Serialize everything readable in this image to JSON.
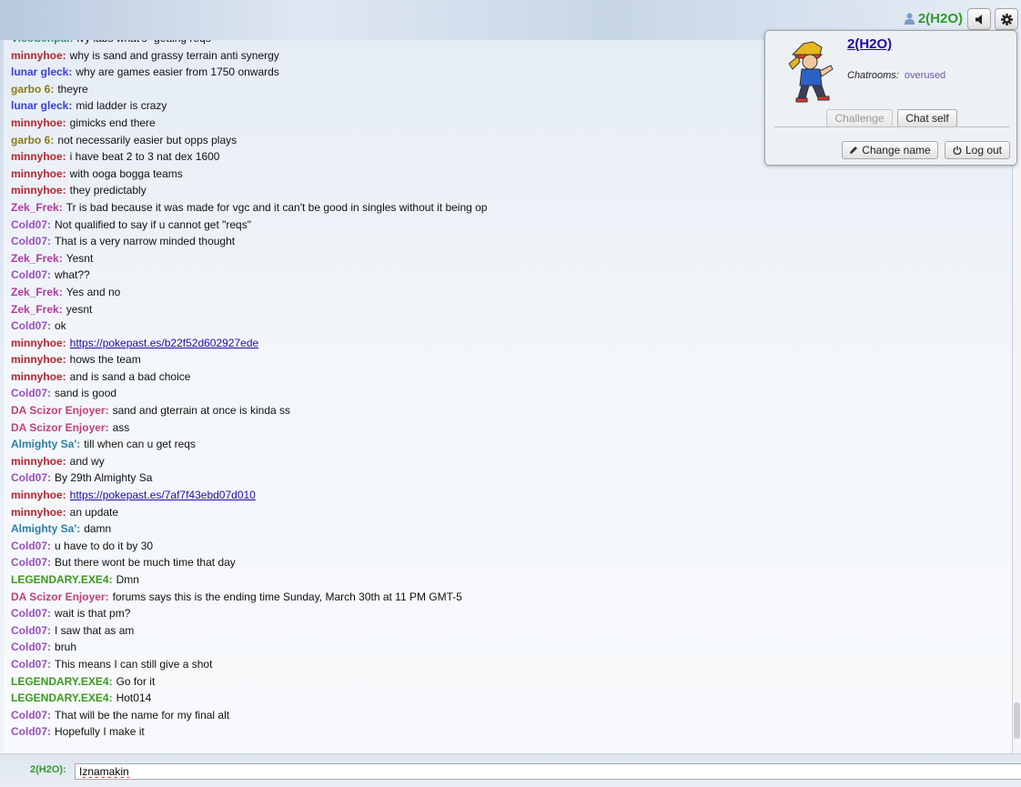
{
  "header": {
    "username": "2(H2O)",
    "colors": {
      "username": "#2d9a2d"
    }
  },
  "chat": {
    "messages": [
      {
        "user": "VicoSenpai:",
        "text": "ivy labs what's \"getting reqs\"",
        "color": "#2f8f6b"
      },
      {
        "user": "minnyhoe:",
        "text": "why is sand and grassy terrain anti synergy",
        "color": "#b3262f"
      },
      {
        "user": "lunar gleck:",
        "text": "why are games easier from 1750 onwards",
        "color": "#3b3fd6"
      },
      {
        "user": "garbo 6:",
        "text": "theyre",
        "color": "#8a7a16"
      },
      {
        "user": "lunar gleck:",
        "text": "mid ladder is crazy",
        "color": "#3b3fd6"
      },
      {
        "user": "minnyhoe:",
        "text": "gimicks end there",
        "color": "#b3262f"
      },
      {
        "user": "garbo 6:",
        "text": "not necessarily easier but opps plays",
        "color": "#8a7a16"
      },
      {
        "user": "minnyhoe:",
        "text": "i have beat 2 to 3 nat dex 1600",
        "color": "#b3262f"
      },
      {
        "user": "minnyhoe:",
        "text": "with ooga bogga teams",
        "color": "#b3262f"
      },
      {
        "user": "minnyhoe:",
        "text": "they predictably",
        "color": "#b3262f"
      },
      {
        "user": "Zek_Frek:",
        "text": "Tr is bad because it was made for vgc and it can't be good in singles without it being op",
        "color": "#b23a9a"
      },
      {
        "user": "Cold07:",
        "text": "Not qualified to say if u cannot get \"reqs\"",
        "color": "#9b4fc0"
      },
      {
        "user": "Cold07:",
        "text": "That is a very narrow minded thought",
        "color": "#9b4fc0"
      },
      {
        "user": "Zek_Frek:",
        "text": "Yesnt",
        "color": "#b23a9a"
      },
      {
        "user": "Cold07:",
        "text": "what??",
        "color": "#9b4fc0"
      },
      {
        "user": "Zek_Frek:",
        "text": "Yes and no",
        "color": "#b23a9a"
      },
      {
        "user": "Zek_Frek:",
        "text": "yesnt",
        "color": "#b23a9a"
      },
      {
        "user": "Cold07:",
        "text": "ok",
        "color": "#9b4fc0"
      },
      {
        "user": "minnyhoe:",
        "link": "https://pokepast.es/b22f52d602927ede",
        "color": "#b3262f"
      },
      {
        "user": "minnyhoe:",
        "text": "hows the team",
        "color": "#b3262f"
      },
      {
        "user": "minnyhoe:",
        "text": "and is sand a bad choice",
        "color": "#b3262f"
      },
      {
        "user": "Cold07:",
        "text": "sand is good",
        "color": "#9b4fc0"
      },
      {
        "user": "DA Scizor Enjoyer:",
        "text": "sand and gterrain at once is kinda ss",
        "color": "#c0407a"
      },
      {
        "user": "DA Scizor Enjoyer:",
        "text": "ass",
        "color": "#c0407a"
      },
      {
        "user": "Almighty Sa':",
        "text": "till when can u get reqs",
        "color": "#2b7fa8"
      },
      {
        "user": "minnyhoe:",
        "text": "and wy",
        "color": "#b3262f"
      },
      {
        "user": "Cold07:",
        "text": "By 29th Almighty Sa",
        "color": "#9b4fc0"
      },
      {
        "user": "minnyhoe:",
        "link": "https://pokepast.es/7af7f43ebd07d010",
        "color": "#b3262f"
      },
      {
        "user": "minnyhoe:",
        "text": "an update",
        "color": "#b3262f"
      },
      {
        "user": "Almighty Sa':",
        "text": "damn",
        "color": "#2b7fa8"
      },
      {
        "user": "Cold07:",
        "text": "u have to do it by 30",
        "color": "#9b4fc0"
      },
      {
        "user": "Cold07:",
        "text": "But there wont be much time that day",
        "color": "#9b4fc0"
      },
      {
        "user": "LEGENDARY.EXE4:",
        "text": "Dmn",
        "color": "#3c9a1e"
      },
      {
        "user": "DA Scizor Enjoyer:",
        "text": "forums says this is the ending time Sunday, March 30th at 11 PM GMT-5",
        "color": "#c0407a"
      },
      {
        "user": "Cold07:",
        "text": "wait is that pm?",
        "color": "#9b4fc0"
      },
      {
        "user": "Cold07:",
        "text": "I saw that as am",
        "color": "#9b4fc0"
      },
      {
        "user": "Cold07:",
        "text": "bruh",
        "color": "#9b4fc0"
      },
      {
        "user": "Cold07:",
        "text": "This means I can still give a shot",
        "color": "#9b4fc0"
      },
      {
        "user": "LEGENDARY.EXE4:",
        "text": "Go for it",
        "color": "#3c9a1e"
      },
      {
        "user": "LEGENDARY.EXE4:",
        "text": "Hot014",
        "color": "#3c9a1e"
      },
      {
        "user": "Cold07:",
        "text": "That will be the name for my final alt",
        "color": "#9b4fc0"
      },
      {
        "user": "Cold07:",
        "text": "Hopefully I make it",
        "color": "#9b4fc0"
      }
    ]
  },
  "composer": {
    "user_label": "2(H2O):",
    "input_value": "Iznamakin"
  },
  "popup": {
    "name": "2(H2O)",
    "chatrooms_label": "Chatrooms:",
    "chatroom": "overused",
    "challenge_label": "Challenge",
    "chat_self_label": "Chat self",
    "change_name_label": "Change name",
    "log_out_label": "Log out"
  }
}
